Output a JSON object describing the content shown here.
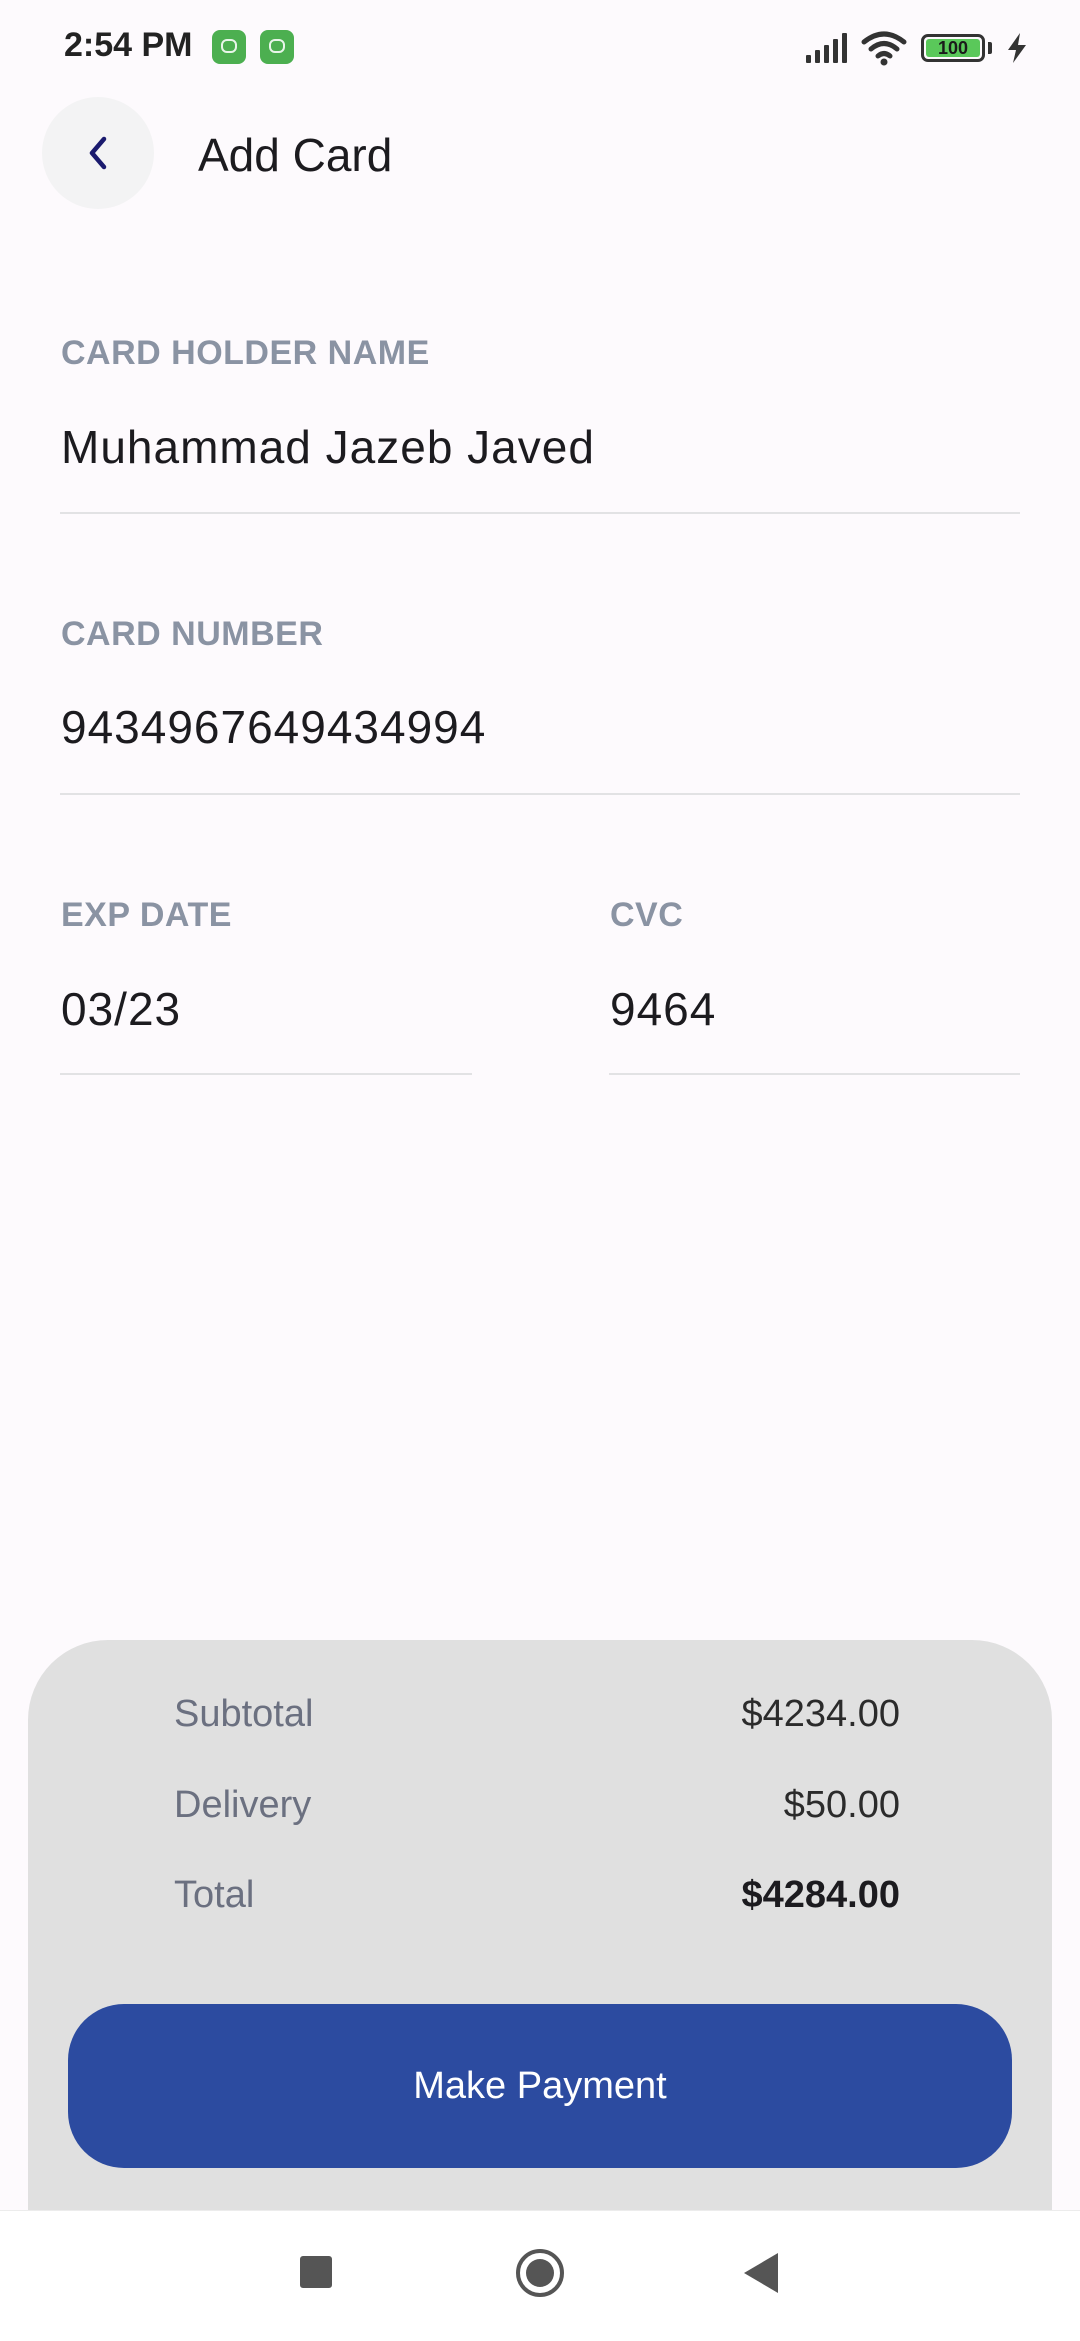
{
  "status_bar": {
    "time": "2:54 PM",
    "battery": "100",
    "notification_icons": [
      "app-notification-icon",
      "app-notification-icon"
    ],
    "icons": [
      "signal-icon",
      "wifi-icon",
      "battery-icon",
      "charging-bolt-icon"
    ]
  },
  "header": {
    "back_icon": "chevron-left-icon",
    "title": "Add Card"
  },
  "form": {
    "card_holder": {
      "label": "CARD HOLDER NAME",
      "value": "Muhammad Jazeb Javed"
    },
    "card_number": {
      "label": "CARD NUMBER",
      "value": "9434967649434994"
    },
    "exp_date": {
      "label": "EXP DATE",
      "value": "03/23"
    },
    "cvc": {
      "label": "CVC",
      "value": "9464"
    }
  },
  "summary": {
    "subtotal": {
      "label": "Subtotal",
      "value": "$4234.00"
    },
    "delivery": {
      "label": "Delivery",
      "value": "$50.00"
    },
    "total": {
      "label": "Total",
      "value": "$4284.00"
    },
    "pay_button": "Make Payment"
  },
  "nav_bar": {
    "icons": [
      "recents-square-icon",
      "home-circle-icon",
      "back-triangle-icon"
    ]
  },
  "colors": {
    "background": "#fdfafd",
    "accent": "#2c4ba0",
    "label": "#8a93a3",
    "sheet": "#e0e0e0"
  }
}
